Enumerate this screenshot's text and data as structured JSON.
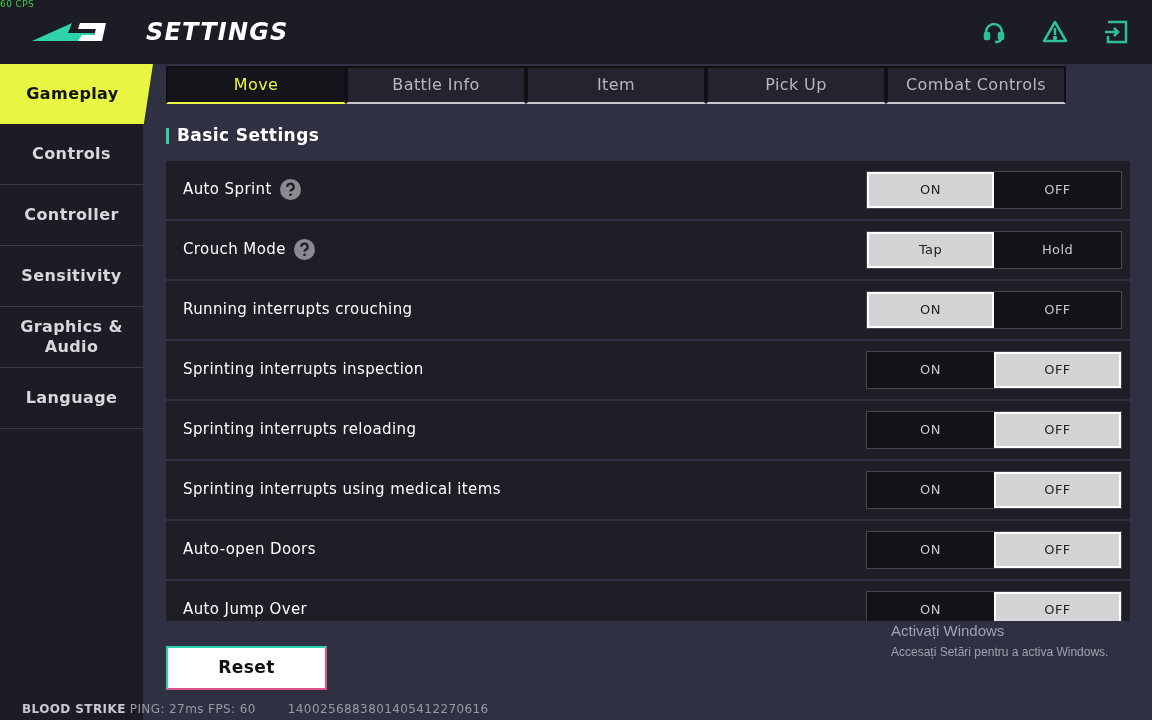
{
  "overlay_counter": "60 CPS",
  "header": {
    "title": "SETTINGS"
  },
  "sidebar": {
    "items": [
      {
        "label": "Gameplay",
        "selected": true
      },
      {
        "label": "Controls",
        "selected": false
      },
      {
        "label": "Controller",
        "selected": false
      },
      {
        "label": "Sensitivity",
        "selected": false
      },
      {
        "label": "Graphics & Audio",
        "selected": false
      },
      {
        "label": "Language",
        "selected": false
      }
    ]
  },
  "tabs": [
    {
      "label": "Move",
      "selected": true
    },
    {
      "label": "Battle Info",
      "selected": false
    },
    {
      "label": "Item",
      "selected": false
    },
    {
      "label": "Pick Up",
      "selected": false
    },
    {
      "label": "Combat Controls",
      "selected": false
    }
  ],
  "section": {
    "title": "Basic Settings"
  },
  "settings": [
    {
      "label": "Auto Sprint",
      "help": true,
      "options": [
        {
          "label": "ON",
          "selected": true
        },
        {
          "label": "OFF",
          "selected": false
        }
      ]
    },
    {
      "label": "Crouch Mode",
      "help": true,
      "options": [
        {
          "label": "Tap",
          "selected": true
        },
        {
          "label": "Hold",
          "selected": false
        }
      ]
    },
    {
      "label": "Running interrupts crouching",
      "help": false,
      "options": [
        {
          "label": "ON",
          "selected": true
        },
        {
          "label": "OFF",
          "selected": false
        }
      ]
    },
    {
      "label": "Sprinting interrupts inspection",
      "help": false,
      "options": [
        {
          "label": "ON",
          "selected": false
        },
        {
          "label": "OFF",
          "selected": true
        }
      ]
    },
    {
      "label": "Sprinting interrupts reloading",
      "help": false,
      "options": [
        {
          "label": "ON",
          "selected": false
        },
        {
          "label": "OFF",
          "selected": true
        }
      ]
    },
    {
      "label": "Sprinting interrupts using medical items",
      "help": false,
      "options": [
        {
          "label": "ON",
          "selected": false
        },
        {
          "label": "OFF",
          "selected": true
        }
      ]
    },
    {
      "label": "Auto-open Doors",
      "help": false,
      "options": [
        {
          "label": "ON",
          "selected": false
        },
        {
          "label": "OFF",
          "selected": true
        }
      ]
    },
    {
      "label": "Auto Jump Over",
      "help": false,
      "options": [
        {
          "label": "ON",
          "selected": false
        },
        {
          "label": "OFF",
          "selected": true
        }
      ]
    }
  ],
  "reset_button": "Reset",
  "status_bar": {
    "game": "BLOOD STRIKE",
    "stats": "PING: 27ms FPS: 60",
    "id": "1400256883801405412270616"
  },
  "windows_notice": {
    "title": "Activați Windows",
    "text": "Accesați Setări pentru a activa Windows."
  }
}
